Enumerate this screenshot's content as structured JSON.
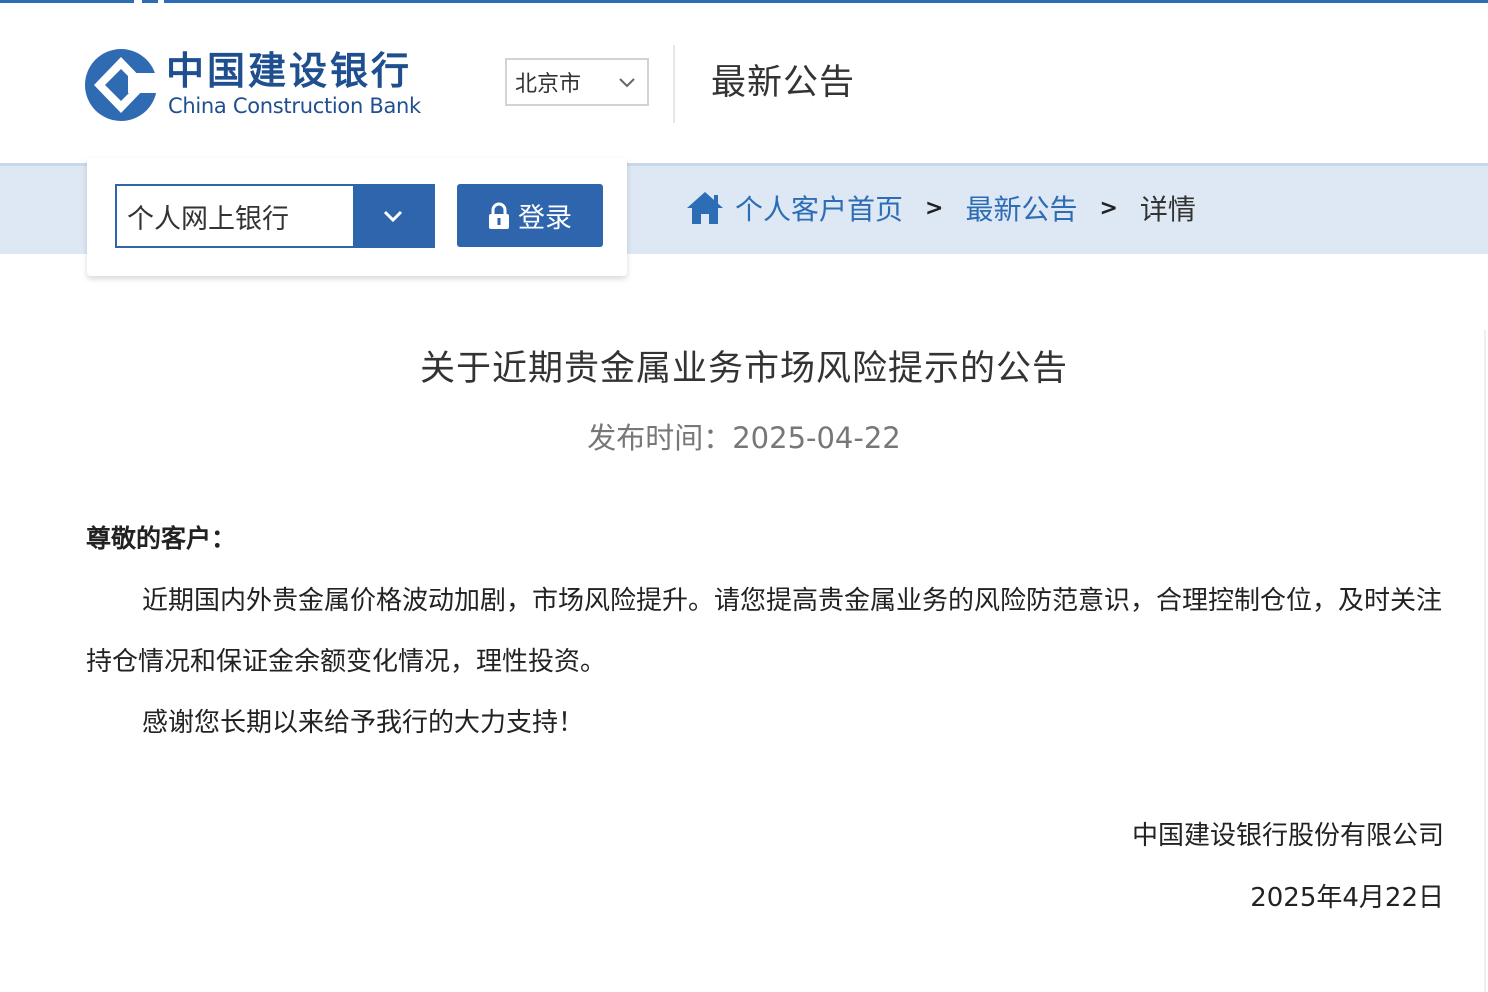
{
  "header": {
    "logo_cn": "中国建设银行",
    "logo_en": "China Construction Bank",
    "city": "北京市",
    "title": "最新公告"
  },
  "login": {
    "bank_type": "个人网上银行",
    "button_label": "登录"
  },
  "breadcrumb": {
    "home": "个人客户首页",
    "sep": ">",
    "section": "最新公告",
    "current": "详情"
  },
  "notice": {
    "title": "关于近期贵金属业务市场风险提示的公告",
    "date": "发布时间：2025-04-22",
    "salutation": "尊敬的客户：",
    "paragraphs": [
      "近期国内外贵金属价格波动加剧，市场风险提升。请您提高贵金属业务的风险防范意识，合理控制仓位，及时关注持仓情况和保证金余额变化情况，理性投资。",
      "感谢您长期以来给予我行的大力支持！"
    ],
    "signature_company": "中国建设银行股份有限公司",
    "signature_date": "2025年4月22日"
  },
  "colors": {
    "brand_blue": "#2f65ad",
    "link_blue": "#2d6db5",
    "nav_band": "#dde8f4"
  },
  "icons": [
    "ccb-logo-icon",
    "chevron-down-icon",
    "lock-icon",
    "home-icon"
  ]
}
